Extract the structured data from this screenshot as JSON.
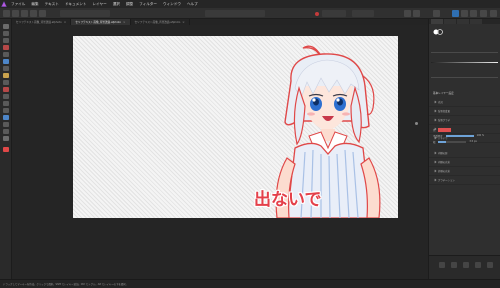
{
  "app": {
    "logo": "affinity-photo-logo"
  },
  "menu": [
    "ファイル",
    "編集",
    "テキスト",
    "ドキュメント",
    "レイヤー",
    "選択",
    "調整",
    "フィルター",
    "ウィンドウ",
    "ヘルプ"
  ],
  "tabs": [
    {
      "label": "セリフテキスト画像_背景透過.afphoto",
      "active": false
    },
    {
      "label": "セリフテキスト画像_背景透過.afphoto",
      "active": true
    },
    {
      "label": "セリフテキスト画像_背景透過.afphoto",
      "active": false
    }
  ],
  "canvas": {
    "caption": "出ないで"
  },
  "right_panel": {
    "section_title": "基本レイヤー設定",
    "layers": [
      "光沢",
      "背景色変更",
      "背景グラデ",
      "輪郭線",
      "シャドウ",
      "内側の影",
      "内側の光彩",
      "外側の光彩",
      "グラデーション",
      "ストローク"
    ],
    "props": [
      {
        "label": "色"
      },
      {
        "label": "不透明度",
        "value": "100 %"
      },
      {
        "label": "幅",
        "value": "3.5 px"
      }
    ],
    "colors": {
      "stroke": "#e05050",
      "accent": "#6ea3d8"
    }
  },
  "status": "ドラッグしてマーキーを作成。クリックで選択。Shift でレイヤー追加。Ctrl でトグル。Alt でレイヤーの下を選択。"
}
